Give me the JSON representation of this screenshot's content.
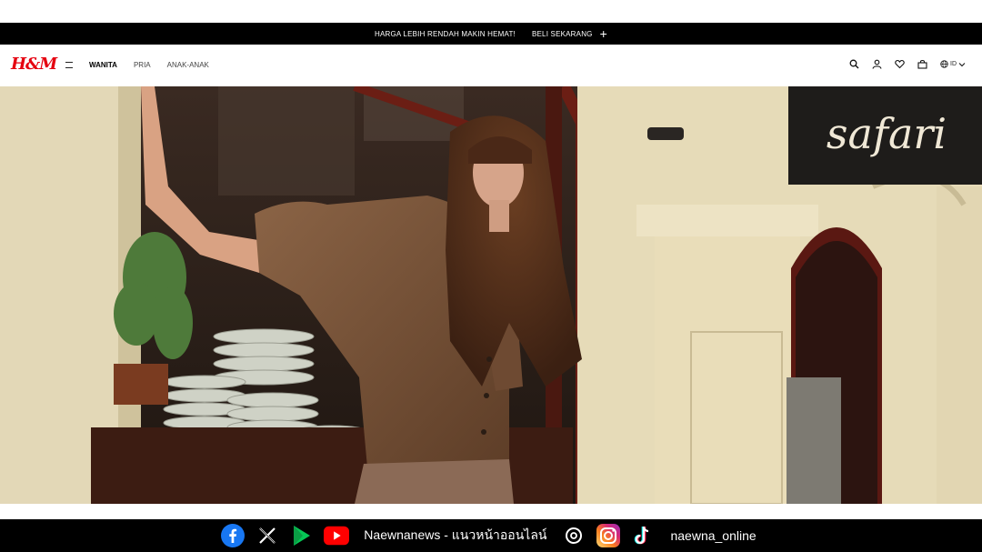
{
  "promo": {
    "text": "HARGA LEBIH RENDAH MAKIN HEMAT!",
    "cta": "BELI SEKARANG"
  },
  "nav": {
    "logo": "H&M",
    "links": [
      "WANITA",
      "PRIA",
      "ANAK-ANAK"
    ],
    "language": "ID"
  },
  "hero": {
    "sign_text": "safari"
  },
  "footer": {
    "brand_text": "Naewnanews - แนวหน้าออนไลน์",
    "handle": "naewna_online"
  },
  "colors": {
    "brand_red": "#e50010",
    "facebook": "#1877f2",
    "youtube": "#ff0000",
    "line_green": "#06c755"
  },
  "icons": [
    "menu-icon",
    "search-icon",
    "account-icon",
    "heart-icon",
    "bag-icon",
    "globe-icon",
    "chevron-down-icon",
    "plus-icon"
  ]
}
